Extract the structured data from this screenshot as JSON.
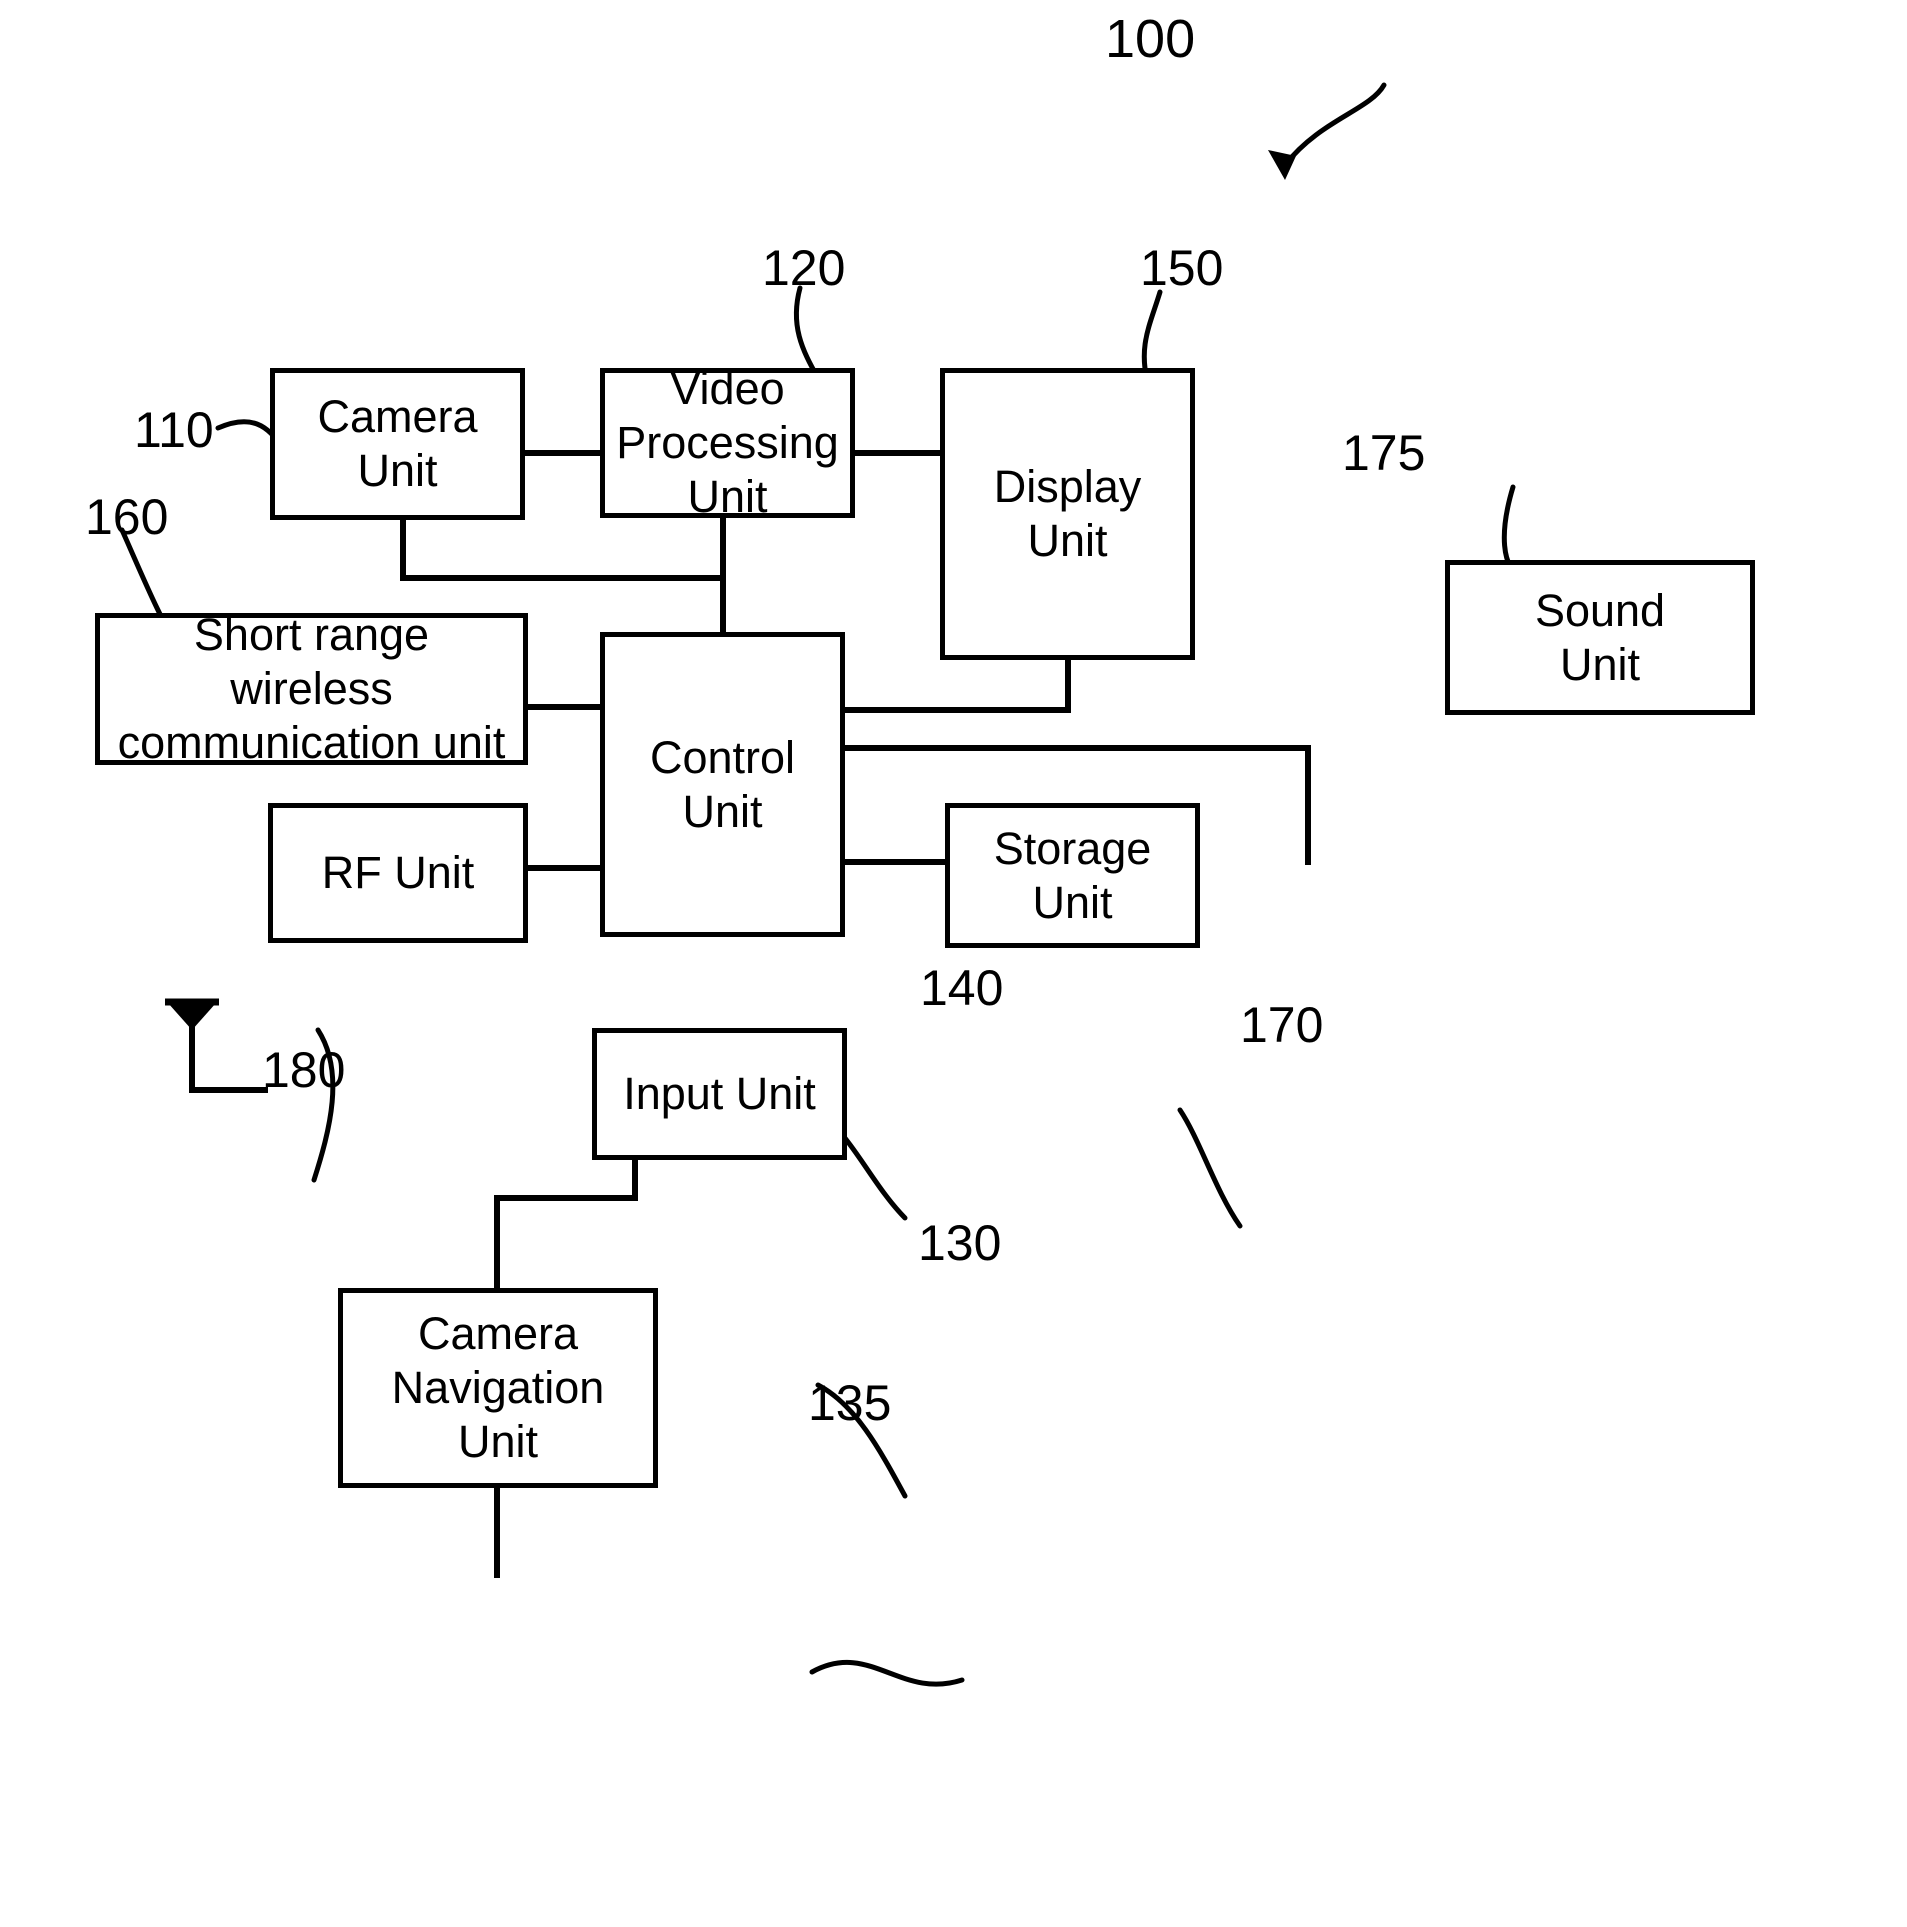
{
  "figure": {
    "type": "patent-block-diagram",
    "system_reference": "100",
    "background_color": "#ffffff",
    "line_color": "#000000"
  },
  "blocks": [
    {
      "id": "camera",
      "label": "Camera\nUnit",
      "ref": "110"
    },
    {
      "id": "video",
      "label": "Video\nProcessing\nUnit",
      "ref": "120"
    },
    {
      "id": "display",
      "label": "Display\nUnit",
      "ref": "150"
    },
    {
      "id": "sound",
      "label": "Sound\nUnit",
      "ref": "175"
    },
    {
      "id": "shortrange",
      "label": "Short range\nwireless\ncommunication unit",
      "ref": "160"
    },
    {
      "id": "control",
      "label": "Control\nUnit",
      "ref": "140"
    },
    {
      "id": "rf",
      "label": "RF Unit",
      "ref": "180"
    },
    {
      "id": "storage",
      "label": "Storage\nUnit",
      "ref": "170"
    },
    {
      "id": "input",
      "label": "Input Unit",
      "ref": "130"
    },
    {
      "id": "cameranav",
      "label": "Camera\nNavigation\nUnit",
      "ref": "135"
    }
  ],
  "reference_numerals": {
    "system": "100",
    "camera": "110",
    "video": "120",
    "input": "130",
    "cameranav": "135",
    "control": "140",
    "display": "150",
    "shortrange": "160",
    "storage": "170",
    "sound": "175",
    "rf": "180"
  },
  "connections": [
    {
      "from": "camera",
      "to": "video"
    },
    {
      "from": "video",
      "to": "display"
    },
    {
      "from": "camera",
      "to": "control"
    },
    {
      "from": "video",
      "to": "control"
    },
    {
      "from": "display",
      "to": "control"
    },
    {
      "from": "sound",
      "to": "control"
    },
    {
      "from": "shortrange",
      "to": "control"
    },
    {
      "from": "rf",
      "to": "control"
    },
    {
      "from": "storage",
      "to": "control"
    },
    {
      "from": "input",
      "to": "control"
    },
    {
      "from": "cameranav",
      "to": "control"
    },
    {
      "from": "antenna",
      "to": "rf"
    }
  ]
}
